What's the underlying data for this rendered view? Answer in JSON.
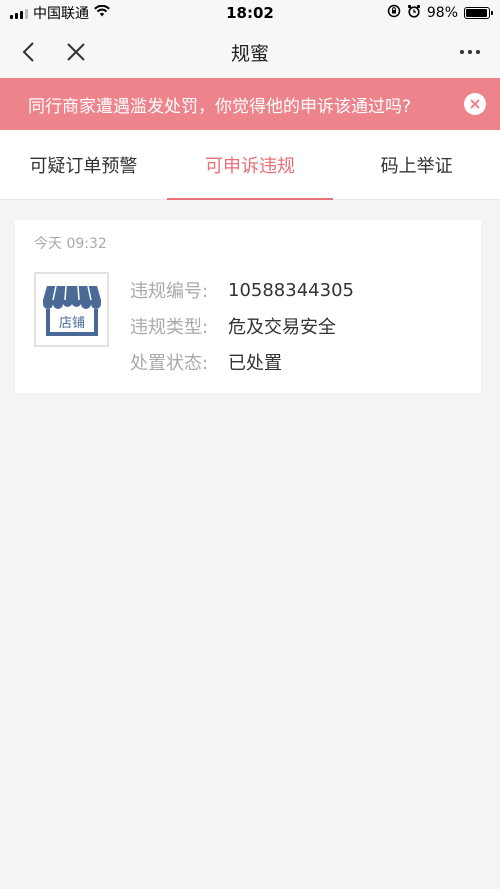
{
  "status_bar": {
    "carrier": "中国联通",
    "time": "18:02",
    "battery": "98%"
  },
  "nav": {
    "title": "规蜜"
  },
  "banner": {
    "text": "同行商家遭遇滥发处罚，你觉得他的申诉该通过吗?"
  },
  "tabs": [
    {
      "label": "可疑订单预警",
      "active": false
    },
    {
      "label": "可申诉违规",
      "active": true
    },
    {
      "label": "码上举证",
      "active": false
    }
  ],
  "card": {
    "time": "今天 09:32",
    "store_icon_label": "店铺",
    "rows": [
      {
        "label": "违规编号:",
        "value": "10588344305"
      },
      {
        "label": "违规类型:",
        "value": "危及交易安全"
      },
      {
        "label": "处置状态:",
        "value": "已处置"
      }
    ]
  },
  "colors": {
    "accent": "#ea6f78",
    "banner_bg": "#ed848b",
    "store_icon": "#4a6a95"
  },
  "icons": [
    "back-icon",
    "close-icon",
    "more-icon",
    "banner-close-icon",
    "wifi-icon",
    "battery-icon",
    "store-icon"
  ]
}
